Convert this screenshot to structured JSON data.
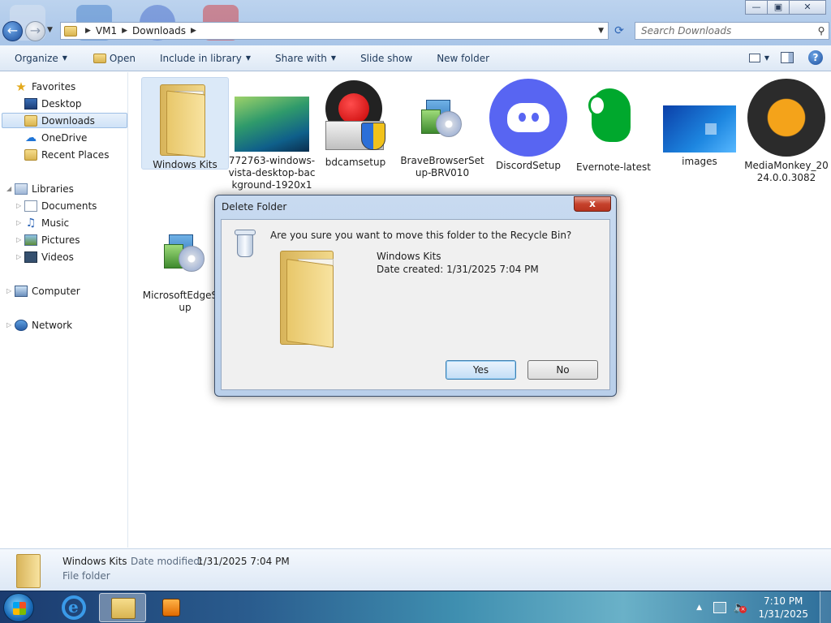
{
  "window": {
    "caption_buttons": {
      "minimize": "—",
      "maximize": "▣",
      "close": "✕"
    }
  },
  "address": {
    "crumbs": [
      "VM1",
      "Downloads"
    ],
    "search_placeholder": "Search Downloads"
  },
  "toolbar": {
    "organize": "Organize",
    "open": "Open",
    "include_in_library": "Include in library",
    "share_with": "Share with",
    "slide_show": "Slide show",
    "new_folder": "New folder",
    "help": "?"
  },
  "sidebar": {
    "favorites": "Favorites",
    "desktop": "Desktop",
    "downloads": "Downloads",
    "onedrive": "OneDrive",
    "recent_places": "Recent Places",
    "libraries": "Libraries",
    "documents": "Documents",
    "music": "Music",
    "pictures": "Pictures",
    "videos": "Videos",
    "computer": "Computer",
    "network": "Network"
  },
  "files": [
    {
      "name": "Windows Kits",
      "icon": "folder-icon",
      "selected": true
    },
    {
      "name": "772763-windows-vista-desktop-background-1920x1",
      "icon": "image-thumbnail"
    },
    {
      "name": "bdcamsetup",
      "icon": "bandicam-icon"
    },
    {
      "name": "BraveBrowserSetup-BRV010",
      "icon": "installer-icon"
    },
    {
      "name": "DiscordSetup",
      "icon": "discord-icon"
    },
    {
      "name": "Evernote-latest",
      "icon": "evernote-icon"
    },
    {
      "name": "images",
      "icon": "image-thumbnail"
    },
    {
      "name": "MediaMonkey_2024.0.0.3082",
      "icon": "mediamonkey-icon"
    },
    {
      "name": "MicrosoftEdgeSetup",
      "icon": "installer-icon"
    }
  ],
  "details": {
    "name": "Windows Kits",
    "modified_label": "Date modified:",
    "modified_value": "1/31/2025 7:04 PM",
    "type": "File folder"
  },
  "dialog": {
    "title": "Delete Folder",
    "close": "x",
    "question": "Are you sure you want to move this folder to the Recycle Bin?",
    "item_name": "Windows Kits",
    "item_date": "Date created: 1/31/2025 7:04 PM",
    "yes": "Yes",
    "no": "No"
  },
  "taskbar": {
    "time": "7:10 PM",
    "date": "1/31/2025"
  }
}
